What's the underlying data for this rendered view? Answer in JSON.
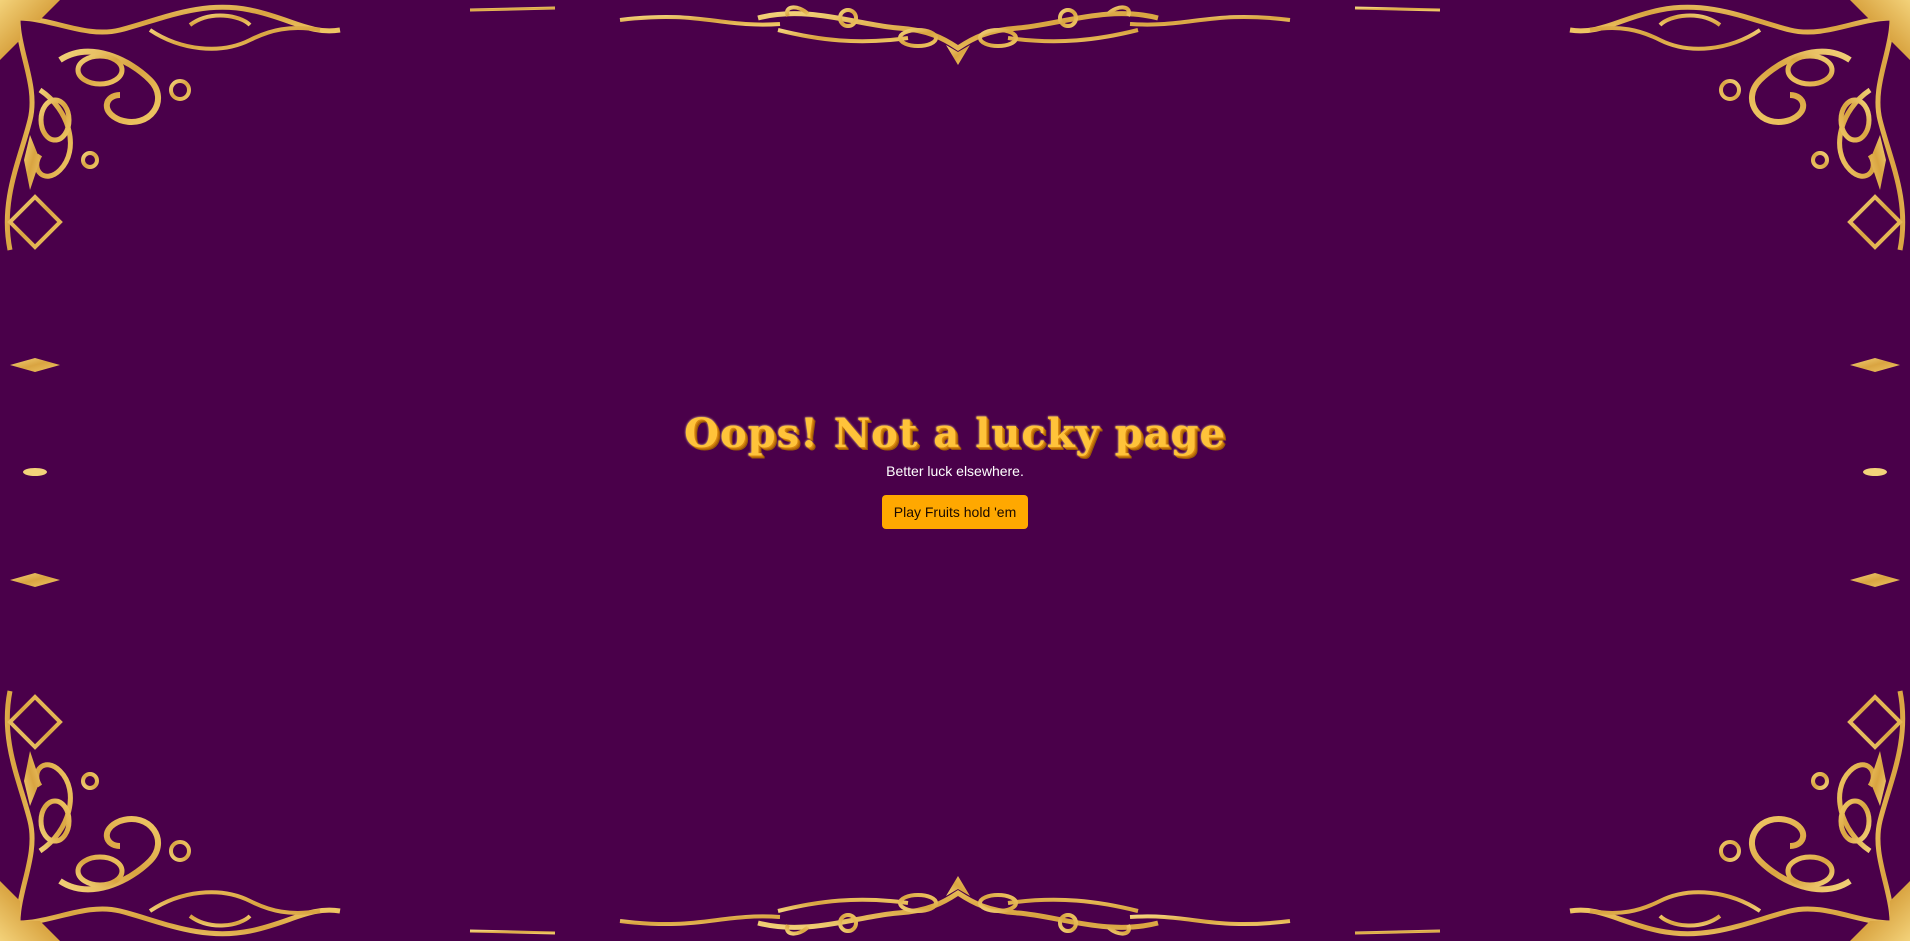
{
  "theme": {
    "background": "#4a004a",
    "ornament_gold": "#e0b04c",
    "button_color": "#ffa800",
    "headline_color": "#ffc33a"
  },
  "frame": {
    "icon": "ornate-gold-border"
  },
  "error": {
    "headline": "Oops! Not a lucky page",
    "subtext": "Better luck elsewhere.",
    "cta_label": "Play Fruits hold 'em"
  }
}
